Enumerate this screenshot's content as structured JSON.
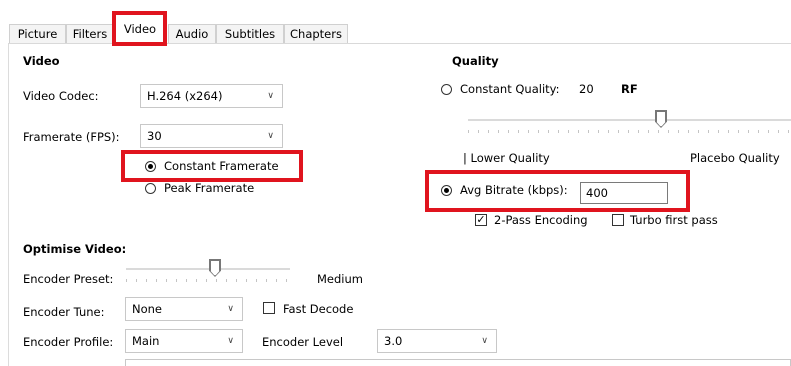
{
  "tabs": [
    {
      "label": "Picture"
    },
    {
      "label": "Filters"
    },
    {
      "label": "Video"
    },
    {
      "label": "Audio"
    },
    {
      "label": "Subtitles"
    },
    {
      "label": "Chapters"
    }
  ],
  "video": {
    "heading": "Video",
    "codec_label": "Video Codec:",
    "codec_value": "H.264 (x264)",
    "framerate_label": "Framerate (FPS):",
    "framerate_value": "30",
    "constant_framerate": "Constant Framerate",
    "peak_framerate": "Peak Framerate",
    "selected_mode": "Constant Framerate"
  },
  "quality": {
    "heading": "Quality",
    "constant_quality_label": "Constant Quality:",
    "constant_quality_value": "20",
    "rf_label": "RF",
    "lower_quality": "| Lower Quality",
    "placebo_quality": "Placebo Quality",
    "avg_bitrate_label": "Avg Bitrate (kbps):",
    "avg_bitrate_value": "400",
    "two_pass_label": "2-Pass Encoding",
    "two_pass_checked": true,
    "turbo_label": "Turbo first pass",
    "turbo_checked": false,
    "selected_mode": "Avg Bitrate (kbps):"
  },
  "optimise": {
    "heading": "Optimise Video:",
    "preset_label": "Encoder Preset:",
    "preset_value": "Medium",
    "tune_label": "Encoder Tune:",
    "tune_value": "None",
    "fast_decode_label": "Fast Decode",
    "fast_decode_checked": false,
    "profile_label": "Encoder Profile:",
    "profile_value": "Main",
    "level_label": "Encoder Level",
    "level_value": "3.0"
  },
  "colors": {
    "highlight": "#e0141e"
  }
}
